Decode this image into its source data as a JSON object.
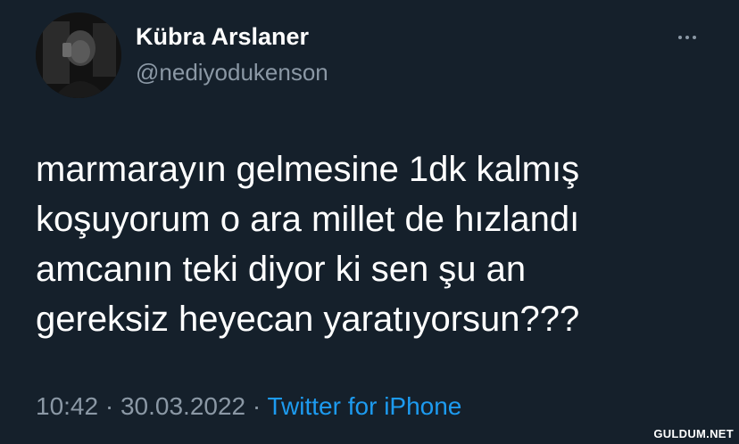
{
  "author": {
    "display_name": "Kübra Arslaner",
    "handle": "@nediyodukenson"
  },
  "tweet": {
    "lines": [
      "marmarayın gelmesine 1dk kalmış",
      "koşuyorum o ara millet de hızlandı",
      "amcanın teki diyor ki sen şu an",
      "gereksiz heyecan yaratıyorsun???"
    ]
  },
  "meta": {
    "time": "10:42",
    "separator": "·",
    "date": "30.03.2022",
    "source": "Twitter for iPhone"
  },
  "watermark": "GULDUM.NET",
  "icons": {
    "more": "more-horizontal-icon"
  },
  "colors": {
    "background": "#15202b",
    "secondary_text": "#8b98a5",
    "link": "#1d9bf0"
  }
}
